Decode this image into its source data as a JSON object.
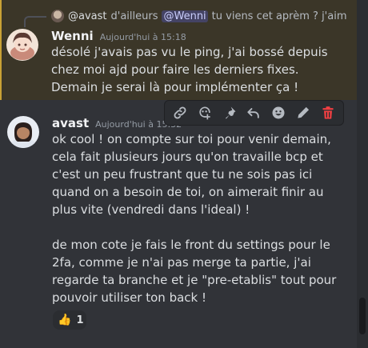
{
  "colors": {
    "background": "#313338",
    "mention_highlight": "#3b3628",
    "mention_bar": "#c9a135",
    "delete_icon": "#f23f42"
  },
  "reply": {
    "author": "@avast",
    "text": "d'ailleurs",
    "mention": "@Wenni",
    "text_after": "tu viens cet aprèm ? j'aim"
  },
  "messages": [
    {
      "author": "Wenni",
      "timestamp": "Aujourd'hui à 15:18",
      "lines": [
        "désolé j'avais pas vu le ping, j'ai bossé depuis",
        "chez moi ajd pour faire les derniers fixes.",
        "Demain je serai là pour implémenter ça !"
      ]
    },
    {
      "author": "avast",
      "timestamp": "Aujourd'hui à 15:32",
      "lines": [
        "ok cool ! on compte sur toi pour venir demain,",
        "cela fait plusieurs jours qu'on travaille bcp et",
        "c'est un peu frustrant que tu ne sois pas ici",
        "quand on a besoin de toi, on aimerait finir au",
        "plus vite (vendredi dans l'ideal) !",
        "",
        "de mon cote je fais le front du settings pour le",
        "2fa, comme je n'ai pas merge ta partie, j'ai",
        "regarde ta branche et je \"pre-etablis\" tout pour",
        "pouvoir utiliser ton back !"
      ],
      "reaction": {
        "emoji": "👍",
        "count": "1"
      }
    }
  ],
  "toolbar_icons": [
    "link-icon",
    "add-reaction-icon",
    "pin-icon",
    "reply-icon",
    "emoji-icon",
    "edit-icon",
    "delete-icon"
  ]
}
